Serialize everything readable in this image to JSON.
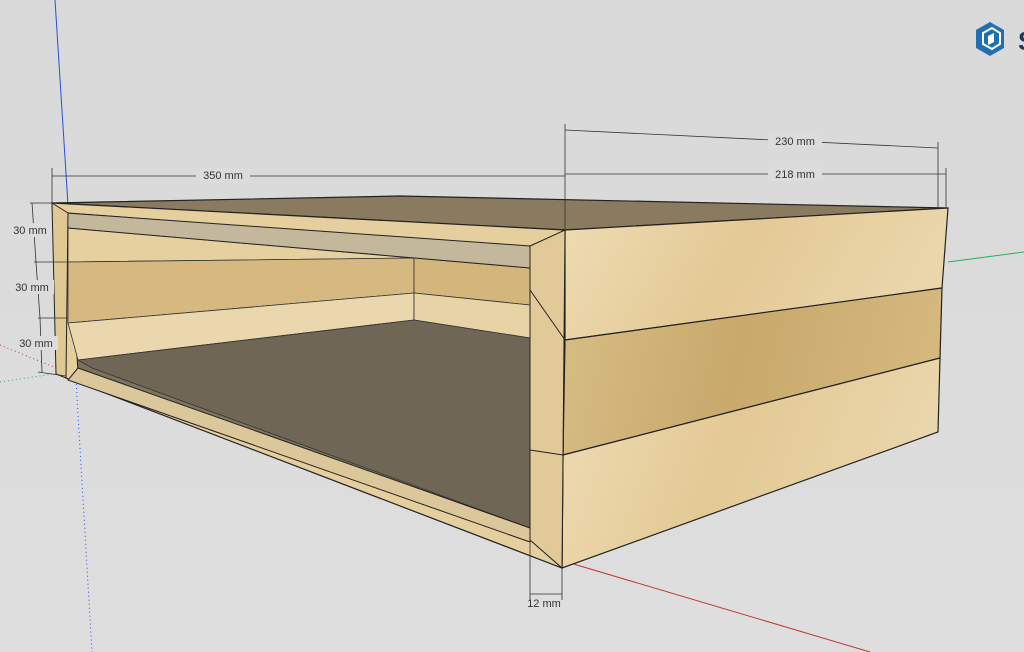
{
  "dimensions": {
    "width_front": "350 mm",
    "depth_outer": "230 mm",
    "depth_inner": "218 mm",
    "height_top": "30 mm",
    "height_middle": "30 mm",
    "height_bottom": "30 mm",
    "wall_thickness": "12 mm"
  },
  "colors": {
    "background": "#dcdcdc",
    "wood_light": "#e8d3a8",
    "wood_mid": "#dcc08c",
    "wood_dark": "#c9a86a",
    "interior_dark": "#6e6a5e",
    "axis_red": "#c0392b",
    "axis_green": "#27ae60",
    "axis_blue": "#2e4fd6",
    "logo_blue": "#1f6fb2"
  },
  "icons": {
    "logo": "sketchup-logo-icon"
  }
}
